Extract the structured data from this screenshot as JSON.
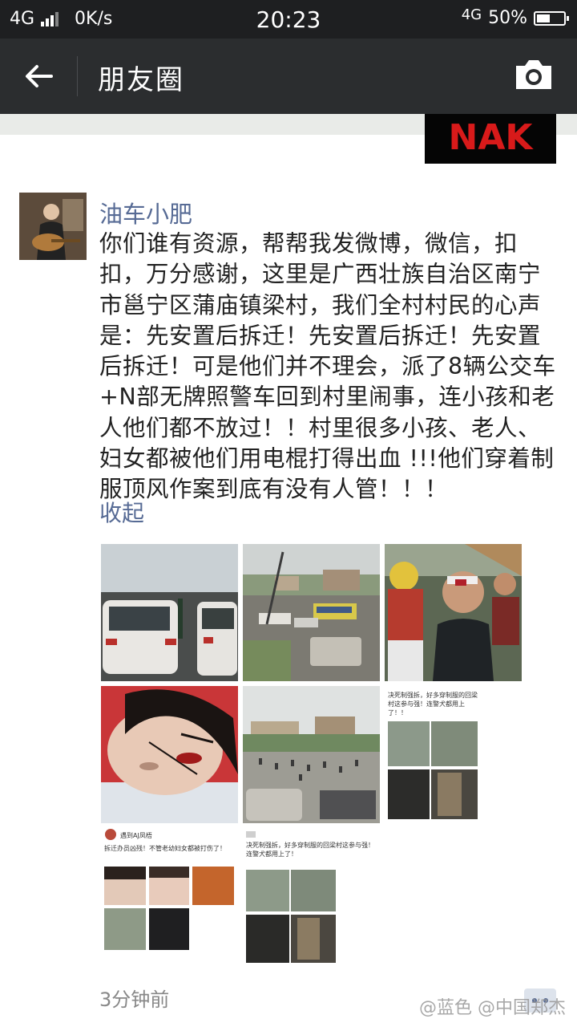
{
  "status_bar": {
    "network_left": "4G",
    "speed": "0K/s",
    "time": "20:23",
    "network_right": "4G",
    "battery": "50%",
    "battery_level": 0.5
  },
  "header": {
    "title": "朋友圈"
  },
  "prev_post": {
    "thumb_text": "NAK"
  },
  "post": {
    "username": "油车小肥",
    "content": "你们谁有资源，帮帮我发微博，微信，扣扣，万分感谢，这里是广西壮族自治区南宁市邕宁区蒲庙镇梁村，我们全村村民的心声是：先安置后拆迁！先安置后拆迁！先安置后拆迁！可是他们并不理会，派了8辆公交车+N部无牌照警车回到村里闹事，连小孩和老人他们都不放过！！村里很多小孩、老人、妇女都被他们用电棍打得出血 !!!他们穿着制服顶风作案到底有没有人管！！！",
    "collapse_label": "收起",
    "time_ago": "3分钟前",
    "photos": [
      {
        "name": "photo-cars-traffic"
      },
      {
        "name": "photo-village-buses"
      },
      {
        "name": "photo-injured-man"
      },
      {
        "name": "photo-injured-woman"
      },
      {
        "name": "photo-crowd-field"
      },
      {
        "name": "photo-screenshot-post",
        "caption": "决死制强拆，好多穿制服的回梁村这参与强！连警犬都用上了！！"
      },
      {
        "name": "photo-screenshot-weibo",
        "user": "遇到AJ凤梧",
        "caption": "拆迁办员凶残！不管老幼妇女都被打伤了！"
      },
      {
        "name": "photo-screenshot-post-2",
        "caption": "决死制强拆，好多穿制服的回梁村这参与强！连警犬都用上了！"
      }
    ]
  },
  "watermark": "@蓝色 @中国郑杰"
}
